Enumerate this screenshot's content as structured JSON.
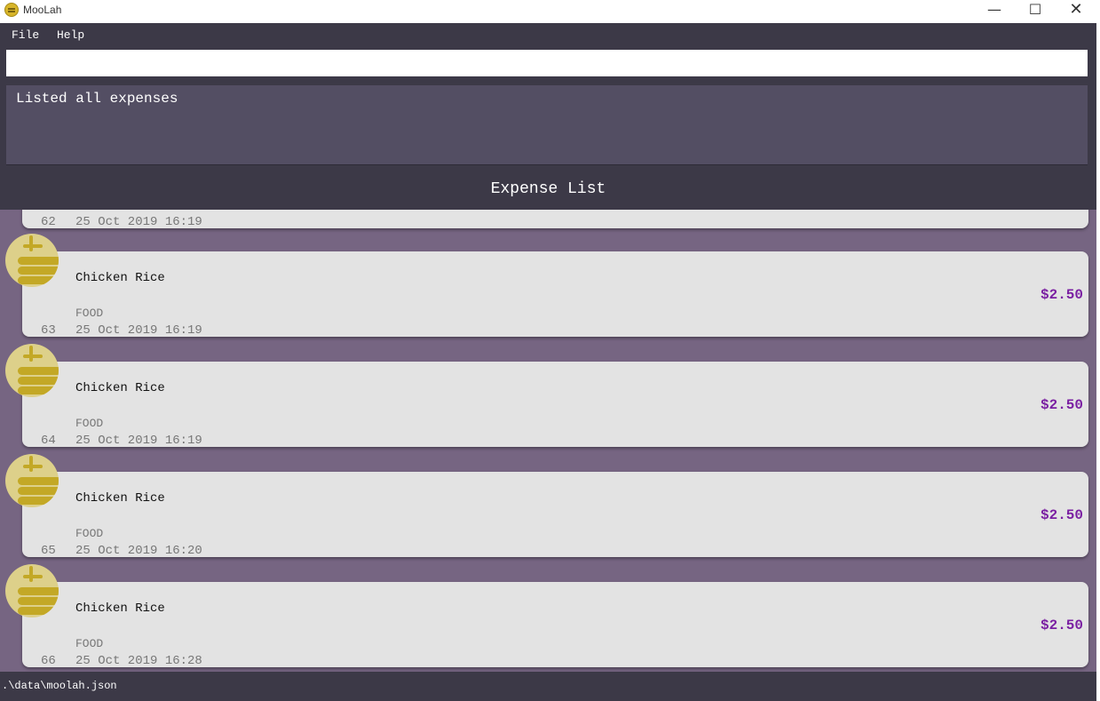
{
  "window": {
    "title": "MooLah",
    "minimize_glyph": "—",
    "maximize_glyph": "☐",
    "close_glyph": "✕"
  },
  "menu": {
    "items": [
      "File",
      "Help"
    ]
  },
  "command": {
    "value": "",
    "placeholder": ""
  },
  "result": {
    "text": "Listed all expenses"
  },
  "list": {
    "title": "Expense List",
    "partial_item": {
      "index": "62",
      "timestamp": "25 Oct 2019 16:19"
    },
    "items": [
      {
        "index": "63",
        "name": "Chicken Rice",
        "category": "FOOD",
        "timestamp": "25 Oct 2019 16:19",
        "price": "$2.50",
        "icon": "food-icon"
      },
      {
        "index": "64",
        "name": "Chicken Rice",
        "category": "FOOD",
        "timestamp": "25 Oct 2019 16:19",
        "price": "$2.50",
        "icon": "food-icon"
      },
      {
        "index": "65",
        "name": "Chicken Rice",
        "category": "FOOD",
        "timestamp": "25 Oct 2019 16:20",
        "price": "$2.50",
        "icon": "food-icon"
      },
      {
        "index": "66",
        "name": "Chicken Rice",
        "category": "FOOD",
        "timestamp": "25 Oct 2019 16:28",
        "price": "$2.50",
        "icon": "food-icon"
      }
    ]
  },
  "status": {
    "path": ".\\data\\moolah.json"
  },
  "colors": {
    "chrome": "#3c3947",
    "result_bg": "#534e63",
    "list_bg": "#766582",
    "card_bg": "#e3e3e3",
    "price": "#7a1fa2",
    "icon_gold": "#c3a826"
  }
}
